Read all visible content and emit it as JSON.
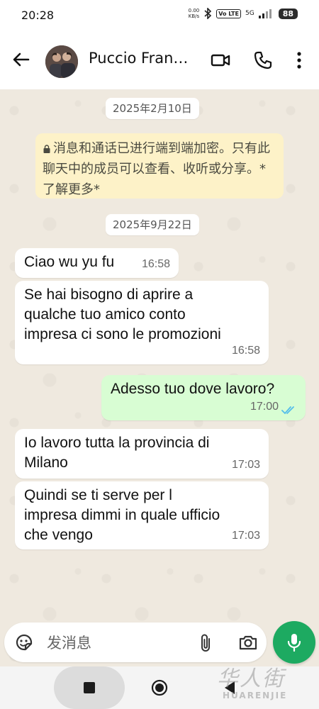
{
  "status_bar": {
    "time": "20:28",
    "net_speed_value": "0.00",
    "net_speed_unit": "KB/s",
    "volte_badge": "Vo LTE",
    "network": "5G",
    "battery": "88"
  },
  "header": {
    "contact_name": "Puccio Fran…",
    "icons": [
      "back-arrow-icon",
      "video-call-icon",
      "phone-icon",
      "more-options-icon"
    ]
  },
  "chat": {
    "date_1": "2025年2月10日",
    "encryption_notice": "消息和通话已进行端到端加密。只有此聊天中的成员可以查看、收听或分享。*了解更多*",
    "date_2": "2025年9月22日",
    "messages": [
      {
        "direction": "incoming",
        "text": "Ciao wu yu fu",
        "time": "16:58"
      },
      {
        "direction": "incoming",
        "text": "Se hai bisogno di aprire a\nqualche tuo amico conto\nimpresa ci sono le promozioni",
        "time": "16:58"
      },
      {
        "direction": "outgoing",
        "text": "Adesso tuo dove lavoro?",
        "time": "17:00",
        "status": "read"
      },
      {
        "direction": "incoming",
        "text": "Io lavoro tutta la provincia di\nMilano",
        "time": "17:03"
      },
      {
        "direction": "incoming",
        "text": "Quindi se ti serve per l\nimpresa dimmi in quale ufficio\nche vengo",
        "time": "17:03"
      }
    ]
  },
  "composer": {
    "placeholder": "发消息"
  },
  "watermark": {
    "cn": "华人街",
    "en": "HUARENJIE"
  },
  "colors": {
    "outgoing_bubble": "#d8fdd3",
    "incoming_bubble": "#ffffff",
    "notice_bg": "#fdf2c8",
    "mic_button": "#1daa61",
    "read_ticks": "#53bdeb"
  }
}
